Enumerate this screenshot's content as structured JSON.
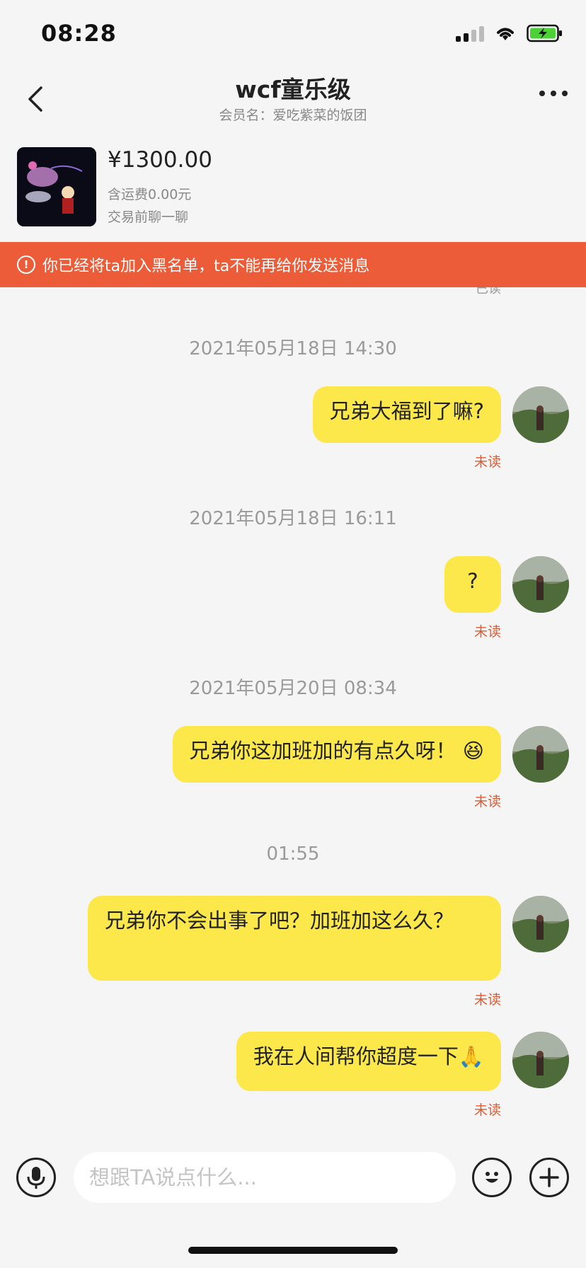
{
  "status_bar": {
    "time": "08:28"
  },
  "header": {
    "title": "wcf童乐级",
    "subtitle": "会员名：爱吃紫菜的饭团"
  },
  "product": {
    "price": "¥1300.00",
    "shipping": "含运费0.00元",
    "cta": "交易前聊一聊"
  },
  "warning": {
    "text": "你已经将ta加入黑名单，ta不能再给你发送消息"
  },
  "chat": {
    "cut_read_label": "已读",
    "timestamps": [
      "2021年05月18日 14:30",
      "2021年05月18日 16:11",
      "2021年05月20日 08:34",
      "01:55"
    ],
    "messages": [
      {
        "text": "兄弟大福到了嘛?",
        "status": "未读"
      },
      {
        "text": "?",
        "status": "未读"
      },
      {
        "text": "兄弟你这加班加的有点久呀！",
        "emoji": "😆",
        "status": "未读"
      },
      {
        "text": "兄弟你不会出事了吧？加班加这么久？",
        "status": "未读"
      },
      {
        "text": "我在人间帮你超度一下",
        "emoji": "🙏",
        "status": "未读"
      }
    ]
  },
  "input_bar": {
    "placeholder": "想跟TA说点什么..."
  },
  "colors": {
    "bubble": "#fce84a",
    "warning": "#ec5c38",
    "unread": "#e8562c"
  },
  "icons": [
    "back-icon",
    "more-icon",
    "warning-icon",
    "mic-icon",
    "emoji-icon",
    "plus-icon"
  ]
}
